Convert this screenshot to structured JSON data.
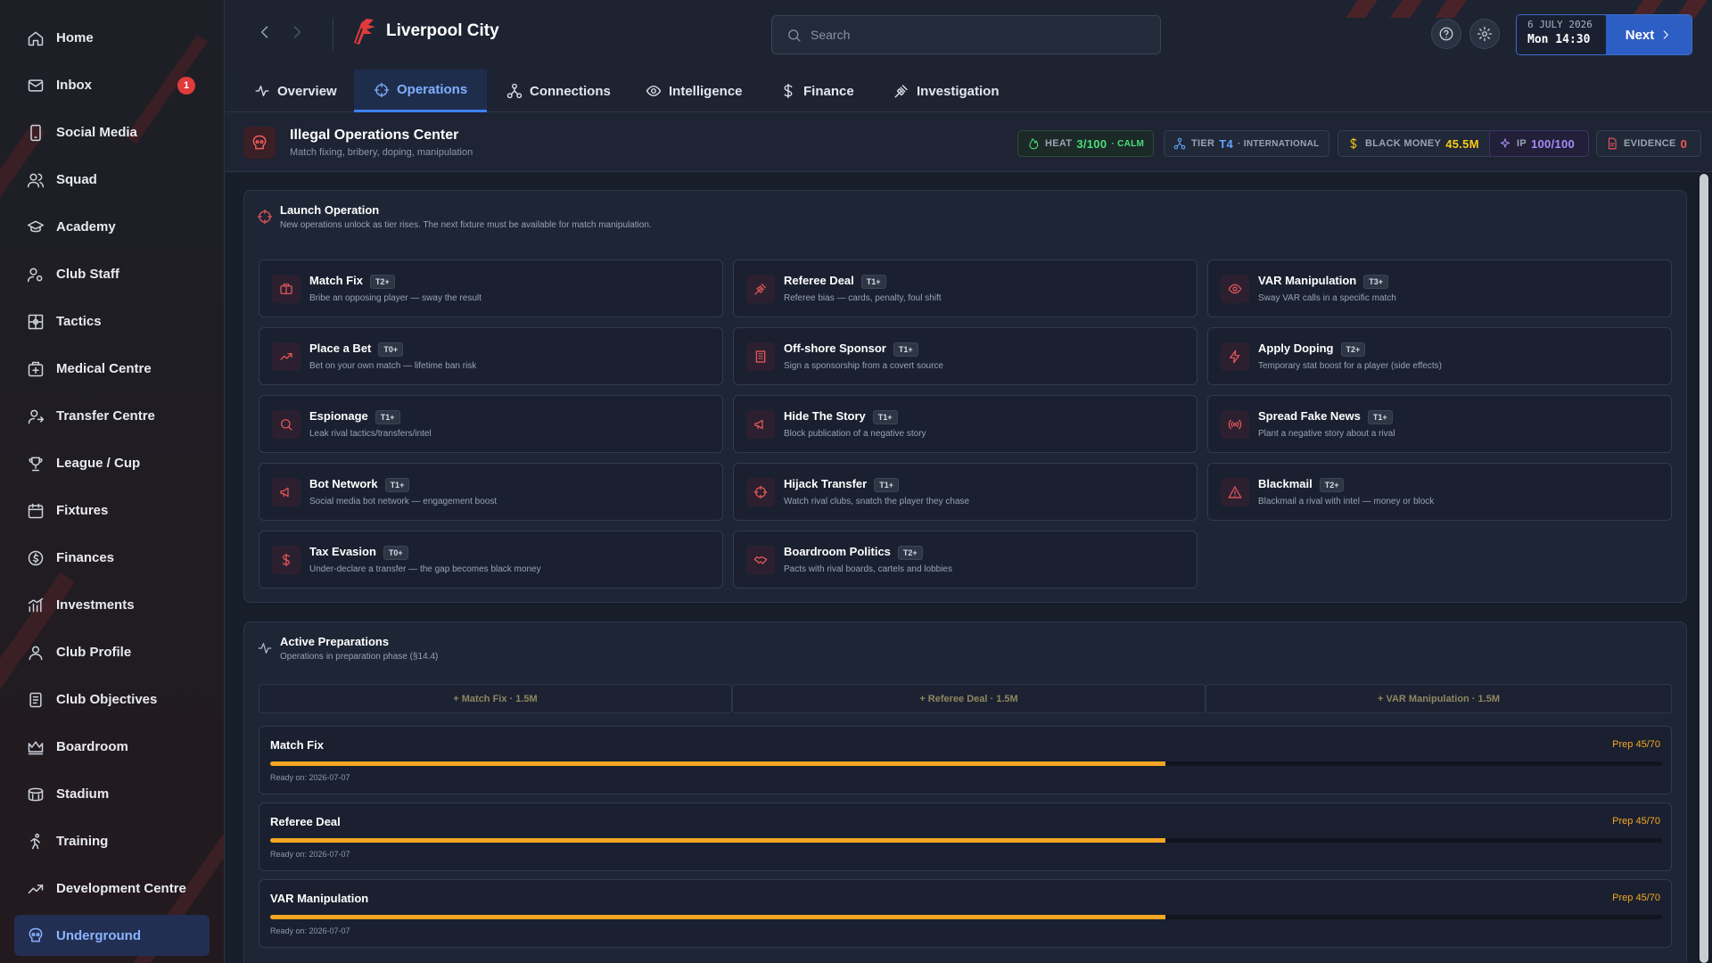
{
  "sidebar": {
    "items": [
      {
        "label": "Home",
        "icon": "home-icon"
      },
      {
        "label": "Inbox",
        "icon": "inbox-icon",
        "badge": "1"
      },
      {
        "label": "Social Media",
        "icon": "phone-icon"
      },
      {
        "label": "Squad",
        "icon": "squad-icon"
      },
      {
        "label": "Academy",
        "icon": "academy-icon"
      },
      {
        "label": "Club Staff",
        "icon": "staff-icon"
      },
      {
        "label": "Tactics",
        "icon": "tactics-icon"
      },
      {
        "label": "Medical Centre",
        "icon": "medical-icon"
      },
      {
        "label": "Transfer Centre",
        "icon": "transfer-icon"
      },
      {
        "label": "League / Cup",
        "icon": "trophy-icon"
      },
      {
        "label": "Fixtures",
        "icon": "calendar-icon"
      },
      {
        "label": "Finances",
        "icon": "finances-icon"
      },
      {
        "label": "Investments",
        "icon": "investments-icon"
      },
      {
        "label": "Club Profile",
        "icon": "profile-icon"
      },
      {
        "label": "Club Objectives",
        "icon": "objectives-icon"
      },
      {
        "label": "Boardroom",
        "icon": "crown-icon"
      },
      {
        "label": "Stadium",
        "icon": "stadium-icon"
      },
      {
        "label": "Training",
        "icon": "training-icon"
      },
      {
        "label": "Development Centre",
        "icon": "trend-icon"
      },
      {
        "label": "Underground",
        "icon": "underground-icon",
        "active": true
      }
    ]
  },
  "topbar": {
    "club_name": "Liverpool City",
    "search_placeholder": "Search",
    "date_line1": "6 JULY 2026",
    "date_line2": "Mon 14:30",
    "next_label": "Next"
  },
  "tabs": [
    {
      "label": "Overview",
      "icon": "activity-icon"
    },
    {
      "label": "Operations",
      "icon": "crosshair-icon",
      "active": true
    },
    {
      "label": "Connections",
      "icon": "network-icon"
    },
    {
      "label": "Intelligence",
      "icon": "eye-icon"
    },
    {
      "label": "Finance",
      "icon": "dollar-icon"
    },
    {
      "label": "Investigation",
      "icon": "gavel-icon"
    }
  ],
  "header": {
    "title": "Illegal Operations Center",
    "subtitle": "Match fixing, bribery, doping, manipulation",
    "stats": {
      "heat_label": "HEAT",
      "heat_value": "3/100",
      "heat_state": "· CALM",
      "tier_label": "TIER",
      "tier_value": "T4",
      "tier_state": "· INTERNATIONAL",
      "money_label": "BLACK MONEY",
      "money_value": "45.5M",
      "ip_label": "IP",
      "ip_value": "100/100",
      "evidence_label": "EVIDENCE",
      "evidence_value": "0"
    }
  },
  "launch": {
    "title": "Launch Operation",
    "subtitle": "New operations unlock as tier rises. The next fixture must be available for match manipulation.",
    "operations": [
      {
        "name": "Match Fix",
        "tier": "T2+",
        "desc": "Bribe an opposing player — sway the result",
        "icon": "briefcase-icon"
      },
      {
        "name": "Referee Deal",
        "tier": "T1+",
        "desc": "Referee bias — cards, penalty, foul shift",
        "icon": "gavel-icon"
      },
      {
        "name": "VAR Manipulation",
        "tier": "T3+",
        "desc": "Sway VAR calls in a specific match",
        "icon": "eye-icon"
      },
      {
        "name": "Place a Bet",
        "tier": "T0+",
        "desc": "Bet on your own match — lifetime ban risk",
        "icon": "trend-up-icon"
      },
      {
        "name": "Off-shore Sponsor",
        "tier": "T1+",
        "desc": "Sign a sponsorship from a covert source",
        "icon": "building-icon"
      },
      {
        "name": "Apply Doping",
        "tier": "T2+",
        "desc": "Temporary stat boost for a player (side effects)",
        "icon": "bolt-icon"
      },
      {
        "name": "Espionage",
        "tier": "T1+",
        "desc": "Leak rival tactics/transfers/intel",
        "icon": "search-icon"
      },
      {
        "name": "Hide The Story",
        "tier": "T1+",
        "desc": "Block publication of a negative story",
        "icon": "megaphone-icon"
      },
      {
        "name": "Spread Fake News",
        "tier": "T1+",
        "desc": "Plant a negative story about a rival",
        "icon": "broadcast-icon"
      },
      {
        "name": "Bot Network",
        "tier": "T1+",
        "desc": "Social media bot network — engagement boost",
        "icon": "megaphone-icon"
      },
      {
        "name": "Hijack Transfer",
        "tier": "T1+",
        "desc": "Watch rival clubs, snatch the player they chase",
        "icon": "crosshair-icon"
      },
      {
        "name": "Blackmail",
        "tier": "T2+",
        "desc": "Blackmail a rival with intel — money or block",
        "icon": "warning-icon"
      },
      {
        "name": "Tax Evasion",
        "tier": "T0+",
        "desc": "Under-declare a transfer — the gap becomes black money",
        "icon": "dollar-icon"
      },
      {
        "name": "Boardroom Politics",
        "tier": "T2+",
        "desc": "Pacts with rival boards, cartels and lobbies",
        "icon": "handshake-icon"
      }
    ]
  },
  "preparations": {
    "title": "Active Preparations",
    "subtitle": "Operations in preparation phase (§14.4)",
    "quick_add": [
      "+ Match Fix · 1.5M",
      "+ Referee Deal · 1.5M",
      "+ VAR Manipulation · 1.5M"
    ],
    "items": [
      {
        "name": "Match Fix",
        "progress_text": "Prep 45/70",
        "progress": 0.643,
        "ready": "Ready on: 2026-07-07"
      },
      {
        "name": "Referee Deal",
        "progress_text": "Prep 45/70",
        "progress": 0.643,
        "ready": "Ready on: 2026-07-07"
      },
      {
        "name": "VAR Manipulation",
        "progress_text": "Prep 45/70",
        "progress": 0.643,
        "ready": "Ready on: 2026-07-07"
      }
    ]
  },
  "colors": {
    "accent": "#3b82f6",
    "danger": "#ef5a5a",
    "progress": "#f5a623",
    "heat": "#4ade80",
    "money": "#facc15",
    "ip": "#a78bfa"
  }
}
